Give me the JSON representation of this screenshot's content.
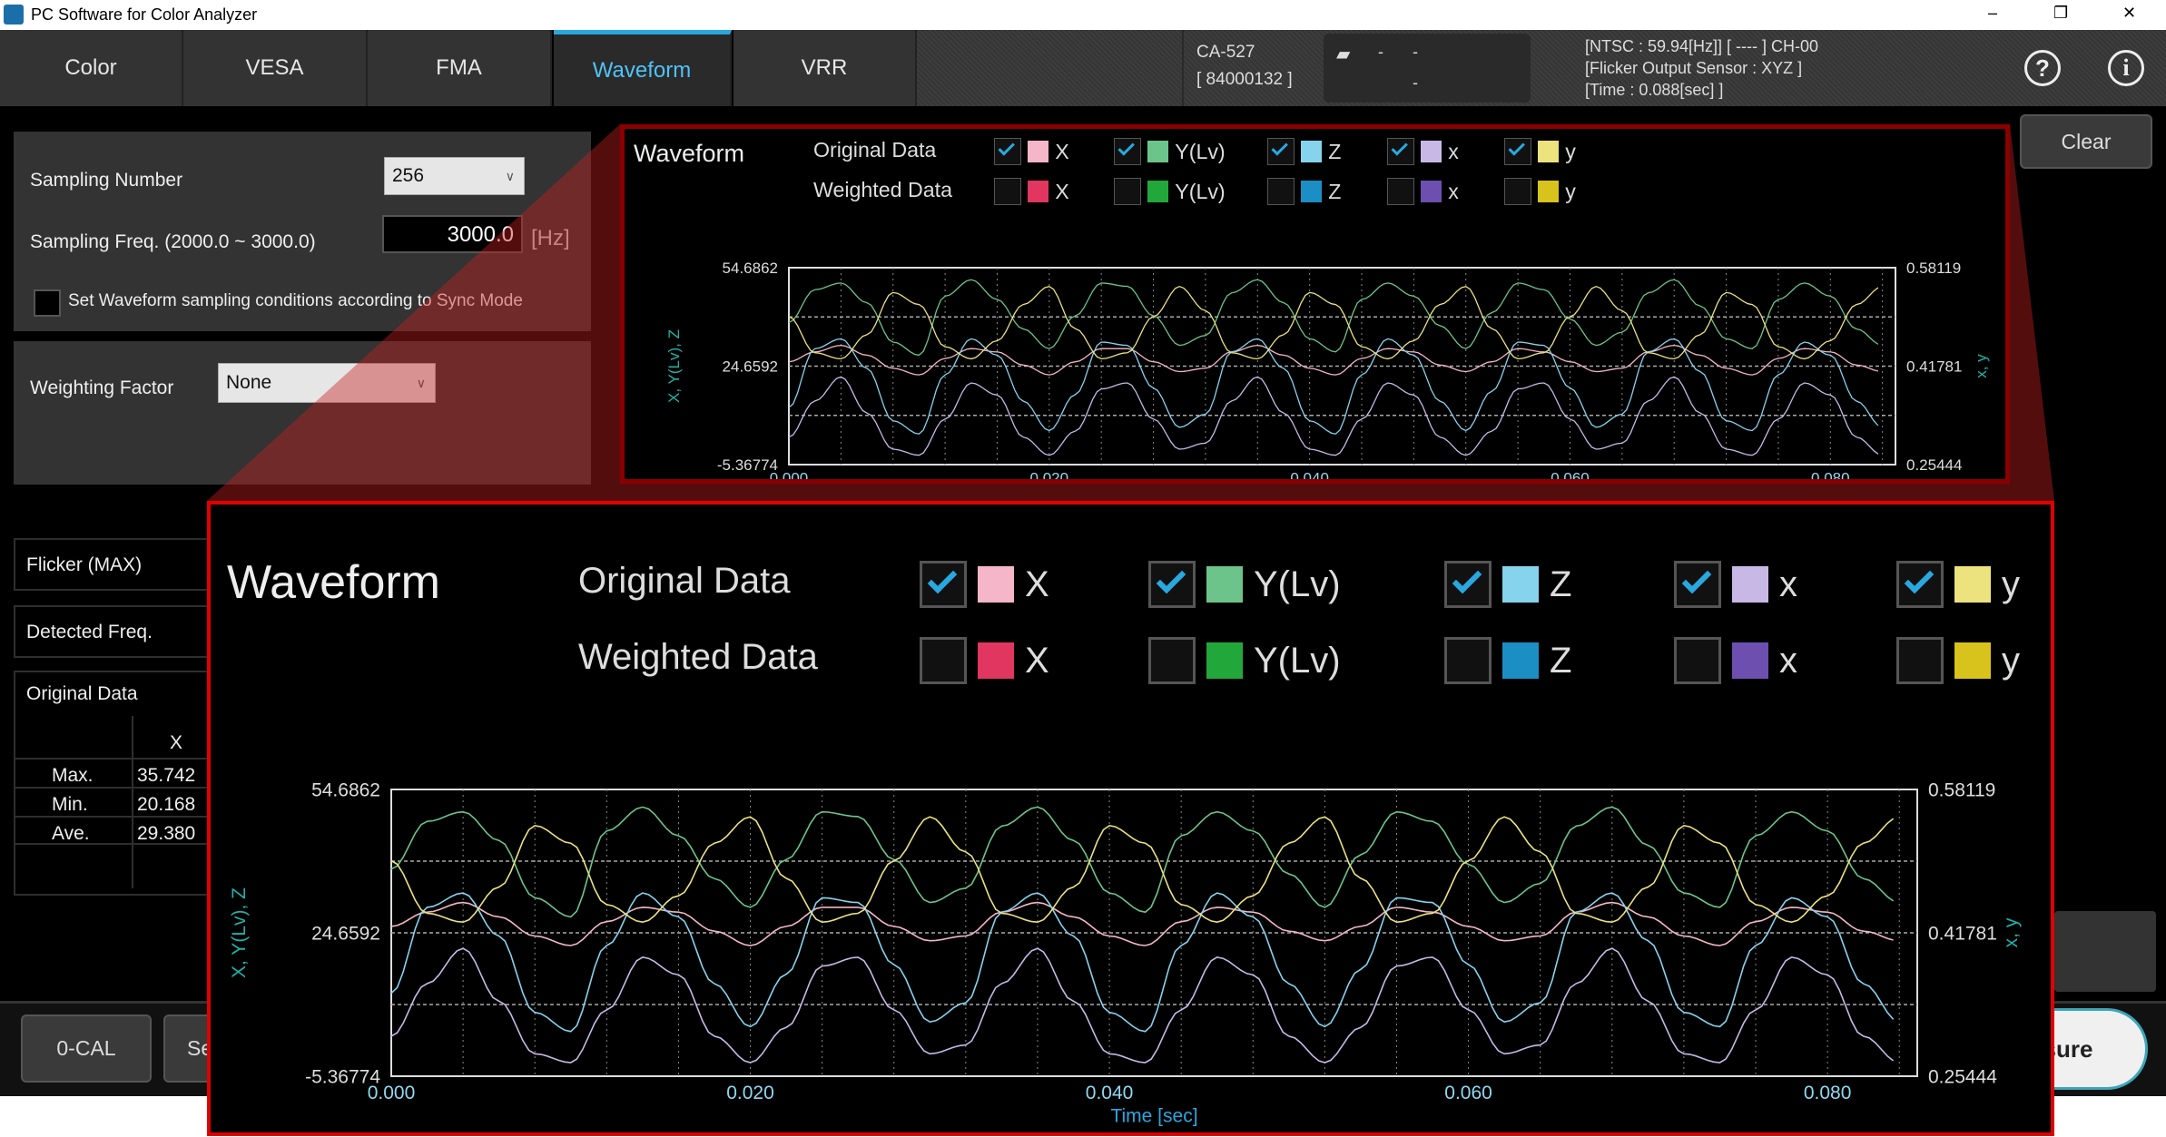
{
  "window": {
    "title": "PC Software for Color Analyzer",
    "minimize": "–",
    "restore": "❐",
    "close": "✕"
  },
  "tabs": [
    {
      "label": "Color"
    },
    {
      "label": "VESA"
    },
    {
      "label": "FMA"
    },
    {
      "label": "Waveform",
      "active": true
    },
    {
      "label": "VRR"
    }
  ],
  "device": {
    "model": "CA-527",
    "serial": "[ 84000132 ]"
  },
  "connection": {
    "icon": "probe-icon",
    "line1a": "-",
    "line1b": "-",
    "line2": "-"
  },
  "status": {
    "line1": "[NTSC :          59.94[Hz]]  [      ----      ]  CH-00",
    "line2": "[Flicker Output Sensor        : XYZ                            ]",
    "line3": "[Time : 0.088[sec]                                                    ]"
  },
  "settings": {
    "sampling_number_label": "Sampling Number",
    "sampling_number_value": "256",
    "sampling_freq_label": "Sampling Freq. (2000.0 ~ 3000.0)",
    "sampling_freq_value": "3000.0",
    "sampling_freq_unit": "[Hz]",
    "sync_checkbox_label": "Set Waveform sampling conditions according to Sync Mode",
    "sync_checked": false,
    "weighting_label": "Weighting Factor",
    "weighting_value": "None"
  },
  "results": {
    "flicker_label": "Flicker (MAX)",
    "detected_label": "Detected Freq.",
    "original_label": "Original Data",
    "col_header": "X",
    "rows": [
      {
        "label": "Max.",
        "value": "35.742"
      },
      {
        "label": "Min.",
        "value": "20.168"
      },
      {
        "label": "Ave.",
        "value": "29.380"
      }
    ]
  },
  "buttons": {
    "zero_cal": "0-CAL",
    "second": "Se",
    "clear": "Clear",
    "measure": "sure"
  },
  "colors": {
    "accent": "#29a8e0",
    "highlight": "#e00000"
  },
  "legend": {
    "original_label": "Original Data",
    "weighted_label": "Weighted Data",
    "original": [
      {
        "name": "X",
        "color": "#f4b6c8",
        "checked": true
      },
      {
        "name": "Y(Lv)",
        "color": "#6cc48a",
        "checked": true
      },
      {
        "name": "Z",
        "color": "#86d3ee",
        "checked": true
      },
      {
        "name": "x",
        "color": "#c8b8e6",
        "checked": true
      },
      {
        "name": "y",
        "color": "#ece27e",
        "checked": true
      }
    ],
    "weighted": [
      {
        "name": "X",
        "color": "#e0365f",
        "checked": false
      },
      {
        "name": "Y(Lv)",
        "color": "#22a83a",
        "checked": false
      },
      {
        "name": "Z",
        "color": "#1b8fc4",
        "checked": false
      },
      {
        "name": "x",
        "color": "#6d4fb0",
        "checked": false
      },
      {
        "name": "y",
        "color": "#d8c21c",
        "checked": false
      }
    ]
  },
  "chart_data": {
    "type": "line",
    "title": "Waveform",
    "xlabel": "Time [sec]",
    "ylabel": "X, Y(Lv), Z",
    "y2label": "x, y",
    "xlim": [
      0,
      0.085
    ],
    "ylim": [
      -5.36774,
      54.6862
    ],
    "y2lim": [
      0.25444,
      0.58119
    ],
    "xticks": [
      "0.000",
      "0.020",
      "0.040",
      "0.060",
      "0.080"
    ],
    "yticks": [
      "54.6862",
      "24.6592",
      "-5.36774"
    ],
    "y2ticks": [
      "0.58119",
      "0.41781",
      "0.25444"
    ],
    "grid": true,
    "x_step": 0.002,
    "series": [
      {
        "name": "X",
        "axis": "left",
        "color": "#f4b6c8",
        "values": [
          26,
          29,
          31,
          28,
          24,
          22,
          27,
          30,
          29,
          25,
          22,
          26,
          30,
          30,
          26,
          23,
          24,
          29,
          31,
          28,
          24,
          22,
          27,
          30,
          29,
          25,
          23,
          26,
          30,
          29,
          26,
          23,
          24,
          29,
          31,
          28,
          24,
          22,
          27,
          30,
          29,
          25,
          23
        ]
      },
      {
        "name": "Y(Lv)",
        "axis": "left",
        "color": "#6cc48a",
        "values": [
          38,
          48,
          50,
          44,
          32,
          28,
          46,
          51,
          45,
          36,
          30,
          40,
          50,
          49,
          40,
          31,
          34,
          47,
          51,
          44,
          33,
          29,
          45,
          50,
          46,
          37,
          30,
          41,
          50,
          48,
          39,
          31,
          35,
          47,
          51,
          43,
          33,
          30,
          45,
          50,
          46,
          36,
          31
        ]
      },
      {
        "name": "Z",
        "axis": "left",
        "color": "#86d3ee",
        "values": [
          12,
          30,
          33,
          24,
          8,
          4,
          22,
          33,
          28,
          14,
          5,
          16,
          32,
          31,
          18,
          6,
          10,
          29,
          33,
          24,
          8,
          4,
          22,
          33,
          28,
          14,
          5,
          17,
          32,
          31,
          18,
          6,
          10,
          29,
          33,
          23,
          8,
          5,
          22,
          32,
          28,
          14,
          6
        ]
      },
      {
        "name": "x",
        "axis": "right",
        "color": "#c8b8e6",
        "values": [
          0.3,
          0.36,
          0.4,
          0.34,
          0.28,
          0.27,
          0.33,
          0.39,
          0.37,
          0.3,
          0.27,
          0.31,
          0.38,
          0.39,
          0.33,
          0.28,
          0.29,
          0.36,
          0.4,
          0.34,
          0.28,
          0.27,
          0.33,
          0.39,
          0.37,
          0.3,
          0.27,
          0.31,
          0.38,
          0.39,
          0.33,
          0.28,
          0.29,
          0.36,
          0.4,
          0.34,
          0.28,
          0.27,
          0.33,
          0.39,
          0.37,
          0.3,
          0.27
        ]
      },
      {
        "name": "y",
        "axis": "right",
        "color": "#ece27e",
        "values": [
          0.5,
          0.44,
          0.43,
          0.47,
          0.54,
          0.52,
          0.45,
          0.43,
          0.46,
          0.52,
          0.55,
          0.48,
          0.43,
          0.44,
          0.5,
          0.55,
          0.51,
          0.44,
          0.43,
          0.47,
          0.54,
          0.52,
          0.45,
          0.43,
          0.46,
          0.52,
          0.55,
          0.48,
          0.43,
          0.44,
          0.5,
          0.55,
          0.51,
          0.44,
          0.43,
          0.47,
          0.54,
          0.52,
          0.45,
          0.43,
          0.46,
          0.52,
          0.55
        ]
      }
    ]
  }
}
